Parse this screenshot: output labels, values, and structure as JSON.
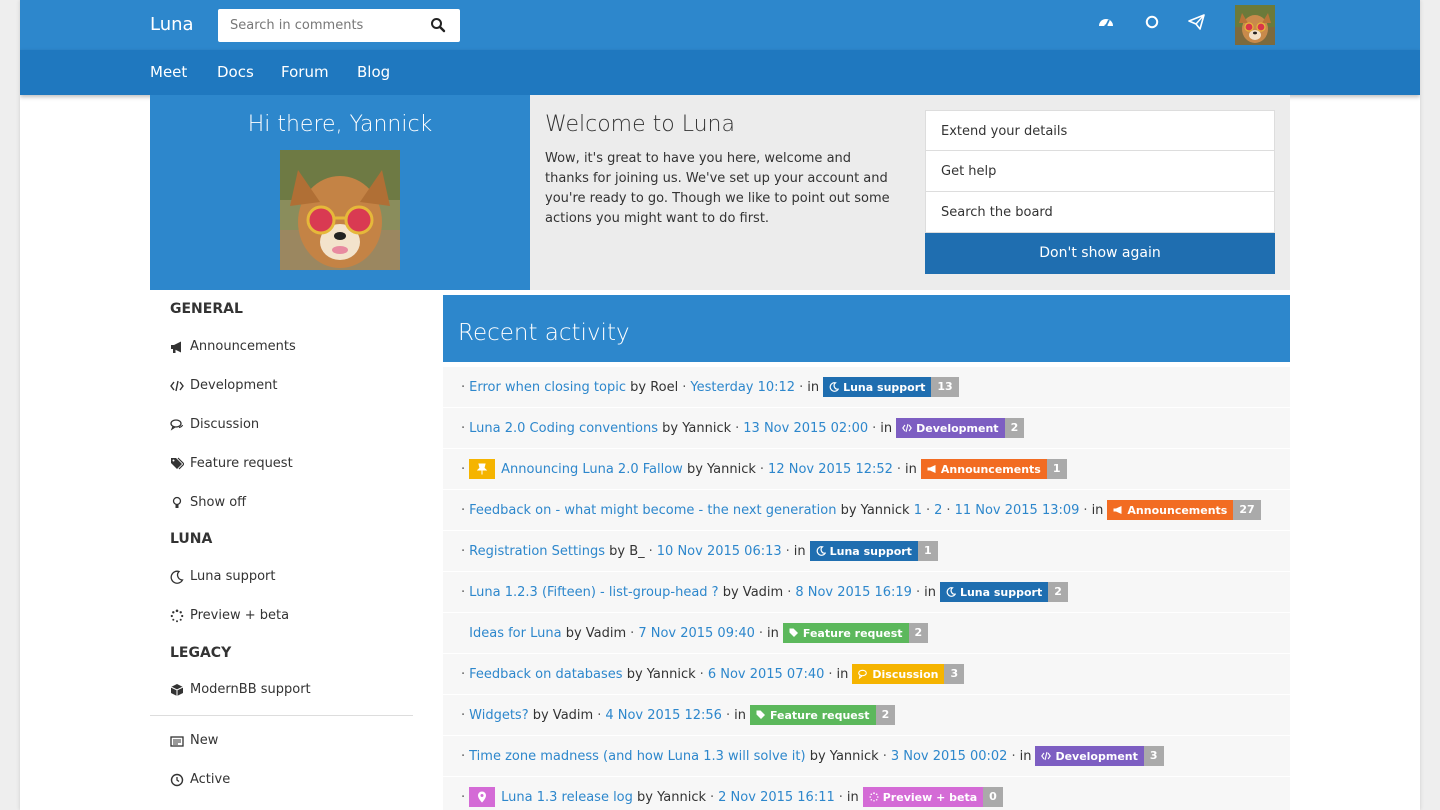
{
  "colors": {
    "primary": "#2d87cc",
    "nav": "#1f78bf",
    "luna_support": "#1f6eb0",
    "development": "#7d5ec2",
    "announcements": "#f26c22",
    "feature_request": "#5cb85c",
    "discussion": "#f5b400",
    "preview_beta": "#d46bd6",
    "count": "#aaaaaa"
  },
  "topbar": {
    "brand": "Luna",
    "search_placeholder": "Search in comments",
    "icons": [
      "dashboard-icon",
      "circle-icon",
      "paper-plane-icon"
    ]
  },
  "nav": [
    "Meet",
    "Docs",
    "Forum",
    "Blog"
  ],
  "hero": {
    "greeting": "Hi there, Yannick",
    "welcome_title": "Welcome to Luna",
    "welcome_text": "Wow, it's great to have you here, welcome and thanks for joining us. We've set up your account and you're ready to go. Though we like to point out some actions you might want to do first.",
    "actions": [
      "Extend your details",
      "Get help",
      "Search the board"
    ],
    "dont_show": "Don't show again"
  },
  "sidebar": {
    "general": "GENERAL",
    "announcements": "Announcements",
    "development": "Development",
    "discussion": "Discussion",
    "feature_request": "Feature request",
    "show_off": "Show off",
    "luna": "LUNA",
    "luna_support": "Luna support",
    "preview_beta": "Preview + beta",
    "legacy": "LEGACY",
    "modernbb": "ModernBB support",
    "new": "New",
    "active": "Active"
  },
  "activity": {
    "title": "Recent activity",
    "rows": [
      {
        "title": "Error when closing topic",
        "by": "by Roel",
        "time": "Yesterday 10:12",
        "in": "in",
        "cat": "Luna support",
        "count": "13"
      },
      {
        "title": "Luna 2.0 Coding conventions",
        "by": "by Yannick",
        "time": "13 Nov 2015 02:00",
        "in": "in",
        "cat": "Development",
        "count": "2"
      },
      {
        "title": "Announcing Luna 2.0 Fallow",
        "by": "by Yannick",
        "time": "12 Nov 2015 12:52",
        "in": "in",
        "cat": "Announcements",
        "count": "1"
      },
      {
        "title": "Feedback on - what might become - the next generation",
        "by": "by Yannick",
        "page1": "1",
        "page2": "2",
        "time": "11 Nov 2015 13:09",
        "in": "in",
        "cat": "Announcements",
        "count": "27"
      },
      {
        "title": "Registration Settings",
        "by": "by B_",
        "time": "10 Nov 2015 06:13",
        "in": "in",
        "cat": "Luna support",
        "count": "1"
      },
      {
        "title": "Luna 1.2.3 (Fifteen) - list-group-head ?",
        "by": "by Vadim",
        "time": "8 Nov 2015 16:19",
        "in": "in",
        "cat": "Luna support",
        "count": "2"
      },
      {
        "title": "Ideas for Luna",
        "by": "by Vadim",
        "time": "7 Nov 2015 09:40",
        "in": "in",
        "cat": "Feature request",
        "count": "2"
      },
      {
        "title": "Feedback on databases",
        "by": "by Yannick",
        "time": "6 Nov 2015 07:40",
        "in": "in",
        "cat": "Discussion",
        "count": "3"
      },
      {
        "title": "Widgets?",
        "by": "by Vadim",
        "time": "4 Nov 2015 12:56",
        "in": "in",
        "cat": "Feature request",
        "count": "2"
      },
      {
        "title": "Time zone madness (and how Luna 1.3 will solve it)",
        "by": "by Yannick",
        "time": "3 Nov 2015 00:02",
        "in": "in",
        "cat": "Development",
        "count": "3"
      },
      {
        "title": "Luna 1.3 release log",
        "by": "by Yannick",
        "time": "2 Nov 2015 16:11",
        "in": "in",
        "cat": "Preview + beta",
        "count": "0"
      }
    ]
  }
}
